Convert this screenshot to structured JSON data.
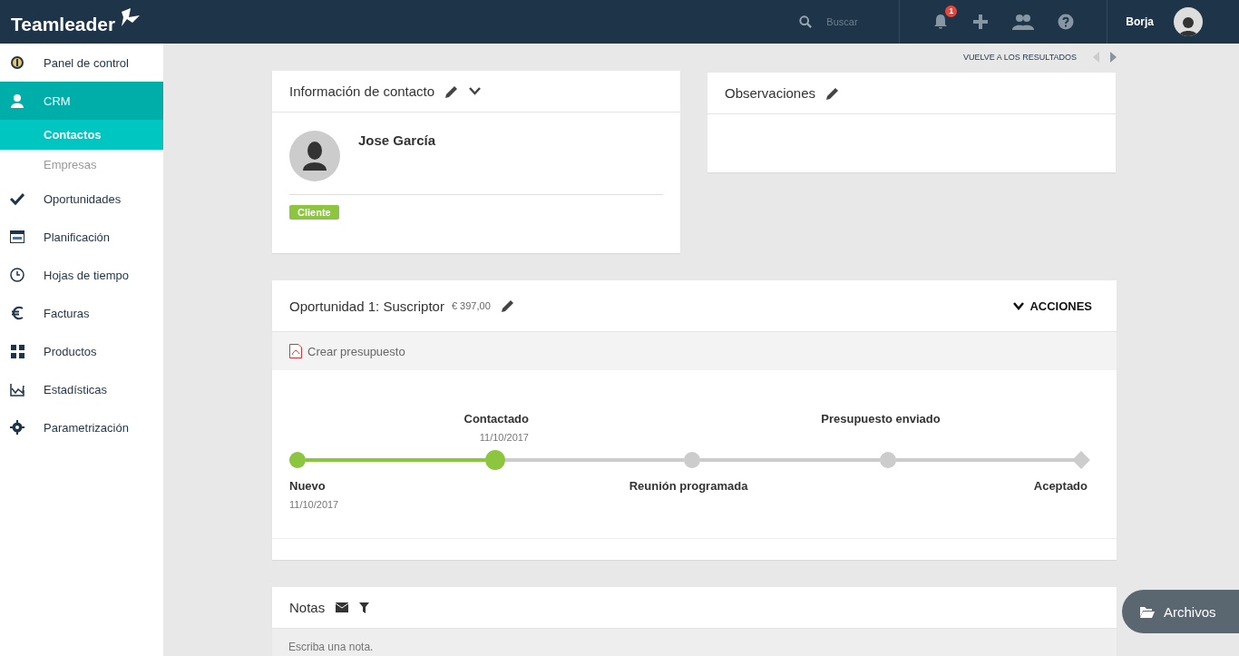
{
  "topbar": {
    "logo": "Teamleader",
    "search": {
      "placeholder": "Buscar"
    },
    "notifications": {
      "count": "1"
    },
    "user": {
      "name": "Borja"
    }
  },
  "sidebar": {
    "items": [
      {
        "label": "Panel de control",
        "kind": "main",
        "selected": false
      },
      {
        "label": "CRM",
        "kind": "main",
        "selected": true
      },
      {
        "label": "Contactos",
        "kind": "sub",
        "selected": true
      },
      {
        "label": "Empresas",
        "kind": "sub",
        "selected": false
      },
      {
        "label": "Oportunidades",
        "kind": "main",
        "selected": false
      },
      {
        "label": "Planificación",
        "kind": "main",
        "selected": false
      },
      {
        "label": "Hojas de tiempo",
        "kind": "main",
        "selected": false
      },
      {
        "label": "Facturas",
        "kind": "main",
        "selected": false
      },
      {
        "label": "Productos",
        "kind": "main",
        "selected": false
      },
      {
        "label": "Estadísticas",
        "kind": "main",
        "selected": false
      },
      {
        "label": "Parametrización",
        "kind": "main",
        "selected": false
      }
    ]
  },
  "back_link": "VUELVE A LOS RESULTADOS",
  "contact_card": {
    "title": "Información de contacto",
    "name": "Jose García",
    "tag": "Cliente"
  },
  "notes_card": {
    "title": "Observaciones"
  },
  "deal_card": {
    "title": "Oportunidad 1: Suscriptor",
    "amount": "€ 397,00",
    "actions": "ACCIONES",
    "toolbar_link": "Crear presupuesto",
    "stages": [
      {
        "label": "Nuevo",
        "date": "11/10/2017",
        "reached": true,
        "selected": false,
        "kind": "dot"
      },
      {
        "label": "Contactado",
        "date": "11/10/2017",
        "reached": true,
        "selected": true,
        "kind": "dot"
      },
      {
        "label": "Reunión programada",
        "reached": false,
        "selected": false,
        "kind": "dot"
      },
      {
        "label": "Presupuesto enviado",
        "reached": false,
        "selected": false,
        "kind": "dot"
      },
      {
        "label": "Aceptado",
        "reached": false,
        "selected": false,
        "kind": "diamond"
      }
    ]
  },
  "notes_section": {
    "title": "Notas",
    "input": {
      "placeholder": "Escriba una nota."
    }
  },
  "files_button": "Archivos"
}
